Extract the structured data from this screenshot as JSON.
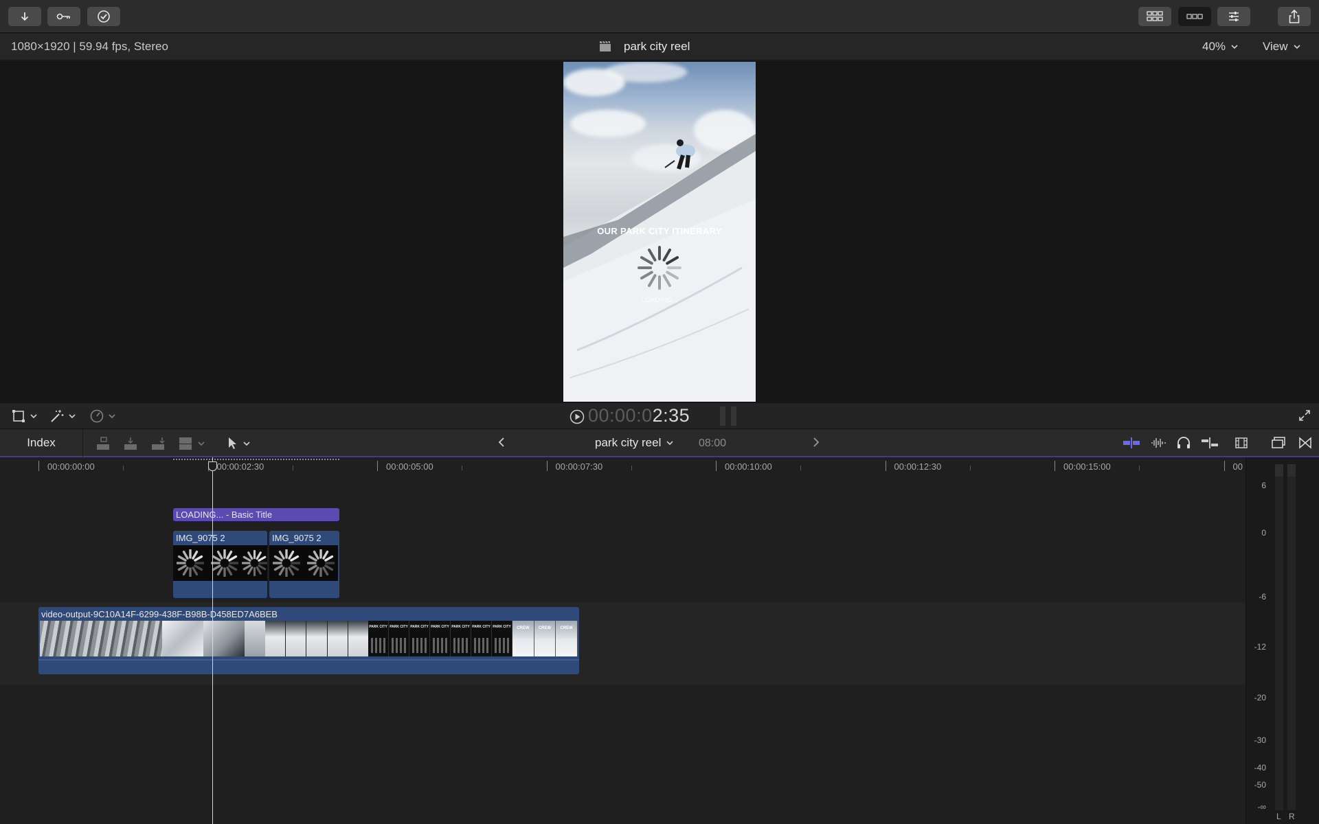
{
  "toolbar": {
    "import_icon": "down-arrow-icon",
    "keywords_icon": "key-icon",
    "background_tasks_icon": "checkmark-circle-icon",
    "browser_icon": "grid-icon",
    "timeline_icon": "filmstrip-icon",
    "inspector_icon": "sliders-icon",
    "share_icon": "share-icon"
  },
  "viewer": {
    "format_info": "1080×1920 | 59.94 fps, Stereo",
    "project_title": "park city reel",
    "zoom": "40%",
    "view_label": "View",
    "overlay_title": "OUR PARK CITY ITINERARY",
    "loading_text": "LOADING..."
  },
  "transport": {
    "timecode_dim": "00:00:0",
    "timecode_bright": "2:35"
  },
  "timeline_header": {
    "index_label": "Index",
    "project_name": "park city reel",
    "duration": "08:00"
  },
  "ruler": {
    "ticks": [
      "00:00:00:00",
      "00:00:02:30",
      "00:00:05:00",
      "00:00:07:30",
      "00:00:10:00",
      "00:00:12:30",
      "00:00:15:00",
      "00"
    ]
  },
  "clips": {
    "title_clip": "LOADING... - Basic Title",
    "connected_clip_a": "IMG_9075 2",
    "connected_clip_b": "IMG_9075 2",
    "primary_clip": "video-output-9C10A14F-6299-438F-B98B-D458ED7A6BEB",
    "thumb_text_park": "PARK CITY",
    "thumb_text_crew": "CREW"
  },
  "meters": {
    "scale": [
      "6",
      "0",
      "-6",
      "-12",
      "-20",
      "-30",
      "-40",
      "-50",
      "-∞"
    ],
    "left_label": "L",
    "right_label": "R"
  },
  "colors": {
    "title_clip": "#5b4bb0",
    "clip_blue": "#2f4a78",
    "playhead": "#d8d8d8",
    "accent_blue": "#6b6bdc"
  }
}
